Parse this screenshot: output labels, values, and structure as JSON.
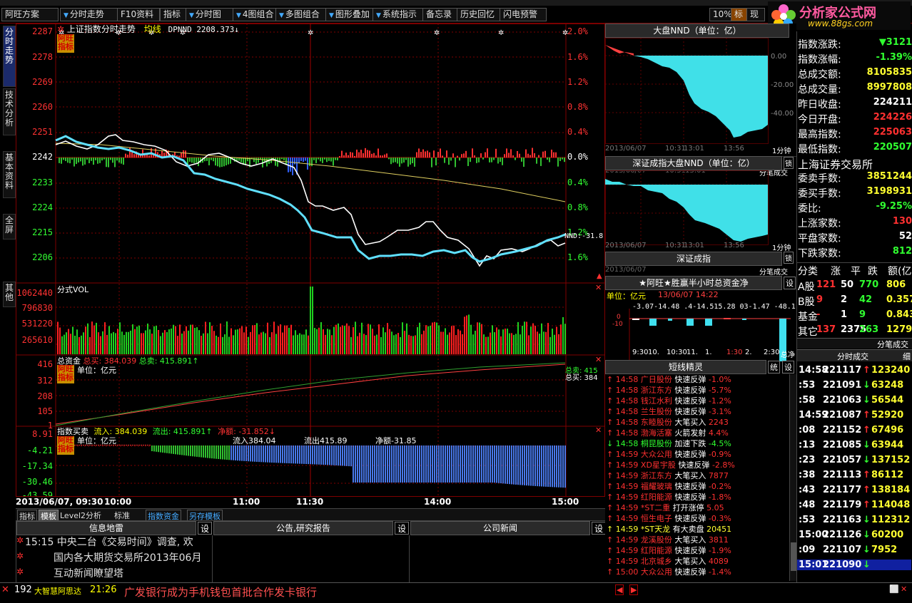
{
  "menu": [
    "阿旺方案",
    "分时走势",
    "F10资料",
    "指标",
    "分时图",
    "4图组合",
    "多图组合",
    "图形叠加",
    "系统指示",
    "备忘录",
    "历史回忆",
    "闪电预警",
    "10%",
    "标",
    "现"
  ],
  "brand": {
    "name": "分析家公式网",
    "url": "www.88gs.com"
  },
  "left_tabs": [
    "分时走势",
    "技术分析",
    "基本资料",
    "全屏",
    "其他"
  ],
  "main": {
    "title": "上证指数分时走势",
    "avg_label": "均线",
    "dpnnd": "DPNND 2208.373↓",
    "y_left": [
      "2287",
      "2278",
      "2269",
      "2260",
      "2251",
      "2242",
      "2233",
      "2224",
      "2215",
      "2206"
    ],
    "y_right": [
      "2.0%",
      "1.6%",
      "1.2%",
      "0.8%",
      "0.4%",
      "0.0%",
      "0.4%",
      "0.8%",
      "1.2%",
      "1.6%"
    ],
    "nnd_tag": "NND:-31.8",
    "badge": "阿旺指标"
  },
  "vol": {
    "title": "分式VOL",
    "y": [
      "1062440",
      "796830",
      "531220",
      "265610"
    ]
  },
  "fund": {
    "title": "总资金",
    "buy": "总买: 384.039",
    "sell": "总卖: 415.891↑",
    "unit": "单位：亿元",
    "y": [
      "416",
      "312",
      "208",
      "105",
      "1"
    ],
    "right1": "总卖: 415",
    "right2": "总买: 384"
  },
  "flow": {
    "title": "指数买卖",
    "in": "流入: 384.039",
    "out": "流出: 415.891↑",
    "net": "净额: -31.852↓",
    "unit": "单位：亿元",
    "in2": "流入384.04",
    "out2": "流出415.89",
    "net2": "净额-31.85",
    "y": [
      "8.91",
      "-4.21",
      "-17.34",
      "-30.46",
      "-43.59"
    ]
  },
  "xaxis": [
    "2013/06/07, 09:30",
    "10:00",
    "11:00",
    "11:30",
    "14:00",
    "15:00"
  ],
  "bottom_tabs": [
    "指标",
    "模板",
    "Level2分析",
    "标准",
    "指数资金",
    "另存模板"
  ],
  "news": {
    "col1": "信息地雷",
    "col2": "公告,研究报告",
    "col3": "公司新闻",
    "set": "设",
    "items": [
      "15:15 中央二台《交易时间》调查, 欢",
      "国内各大期货交易所2013年06月",
      "互动新闻瞭望塔"
    ]
  },
  "mid": {
    "p1_title": "大盘NND（单位：亿）",
    "p1_ticks": [
      "0.00",
      "-20.00",
      "-40.00"
    ],
    "p1_x": [
      "2013/06/07",
      "10:31",
      "13:01",
      "13:56"
    ],
    "p1_unit": "1分钟",
    "p1_sub": "分笔成交",
    "p2_title": "深证成指大盘NND（单位：亿）",
    "p2_x": [
      "2013/06/07",
      "10:31",
      "13:01",
      "13:56"
    ],
    "p2_unit": "1分钟",
    "p2_sub": "分笔成交",
    "p3_title": "深证成指",
    "p4_title": "★阿旺★胜赢半小时总资金净",
    "p4_unit": "单位：亿元",
    "p4_date": "13/06/07 14:22",
    "p4_vals": "-3.07-14.48 .4-14.515.28 03-1.47 -48.1",
    "p4_x": [
      "9:30",
      "10.",
      "10:30",
      "11.",
      "1.",
      "1:30",
      "2.",
      "2:30",
      "总净"
    ],
    "p5_title": "短线精灵",
    "p5_tabs": [
      "统",
      "设"
    ],
    "sprite": [
      {
        "t": "14:58",
        "n": "广日股份",
        "e": "快速反弹",
        "v": "-1.0%",
        "c": "r"
      },
      {
        "t": "14:58",
        "n": "浙江东方",
        "e": "快速反弹",
        "v": "-5.7%",
        "c": "r"
      },
      {
        "t": "14:58",
        "n": "钱江水利",
        "e": "快速反弹",
        "v": "-1.2%",
        "c": "r"
      },
      {
        "t": "14:58",
        "n": "兰生股份",
        "e": "快速反弹",
        "v": "-3.1%",
        "c": "r"
      },
      {
        "t": "14:58",
        "n": "东睦股份",
        "e": "大笔买入",
        "v": "2243",
        "c": "r"
      },
      {
        "t": "14:58",
        "n": "渤海活塞",
        "e": "火箭发射",
        "v": "4.4%",
        "c": "r"
      },
      {
        "t": "14:58",
        "n": "桐昆股份",
        "e": "加速下跌",
        "v": "-4.5%",
        "c": "g"
      },
      {
        "t": "14:59",
        "n": "大众公用",
        "e": "快速反弹",
        "v": "-0.9%",
        "c": "r"
      },
      {
        "t": "14:59",
        "n": "XD星宇股",
        "e": "快速反弹",
        "v": "-2.8%",
        "c": "r"
      },
      {
        "t": "14:59",
        "n": "浙江东方",
        "e": "大笔买入",
        "v": "7877",
        "c": "r"
      },
      {
        "t": "14:59",
        "n": "福耀玻璃",
        "e": "快速反弹",
        "v": "-0.2%",
        "c": "r"
      },
      {
        "t": "14:59",
        "n": "红阳能源",
        "e": "快速反弹",
        "v": "-1.8%",
        "c": "r"
      },
      {
        "t": "14:59",
        "n": "*ST二重",
        "e": "打开涨停",
        "v": "5.05",
        "c": "r"
      },
      {
        "t": "14:59",
        "n": "恒生电子",
        "e": "快速反弹",
        "v": "-0.3%",
        "c": "r"
      },
      {
        "t": "14:59",
        "n": "*ST天龙",
        "e": "有大卖盘",
        "v": "20451",
        "c": "y"
      },
      {
        "t": "14:59",
        "n": "龙溪股份",
        "e": "大笔买入",
        "v": "3811",
        "c": "r"
      },
      {
        "t": "14:59",
        "n": "红阳能源",
        "e": "快速反弹",
        "v": "-1.9%",
        "c": "r"
      },
      {
        "t": "14:59",
        "n": "北京城乡",
        "e": "大笔买入",
        "v": "4089",
        "c": "r"
      },
      {
        "t": "15:00",
        "n": "大众公用",
        "e": "快速反弹",
        "v": "-1.4%",
        "c": "r"
      }
    ]
  },
  "quote": {
    "rows": [
      {
        "k": "指数涨跌:",
        "v": "▼3121"
      },
      {
        "k": "指数涨幅:",
        "v": "-1.39%"
      },
      {
        "k": "总成交额:",
        "v": "8105835"
      },
      {
        "k": "总成交量:",
        "v": "8997808"
      },
      {
        "k": "昨日收盘:",
        "v": "224211"
      },
      {
        "k": "今日开盘:",
        "v": "224226"
      },
      {
        "k": "最高指数:",
        "v": "225063"
      },
      {
        "k": "最低指数:",
        "v": "220507"
      }
    ],
    "exchange": "上海证券交易所",
    "rows2": [
      {
        "k": "委卖手数:",
        "v": "3851244"
      },
      {
        "k": "委买手数:",
        "v": "3198931"
      },
      {
        "k": "委比:",
        "v": "-9.25%"
      },
      {
        "k": "上涨家数:",
        "v": "130"
      },
      {
        "k": "平盘家数:",
        "v": "52"
      },
      {
        "k": "下跌家数:",
        "v": "812"
      }
    ],
    "cat_head": [
      "分类",
      "涨",
      "平",
      "跌",
      "额(亿"
    ],
    "cats": [
      {
        "n": "A股",
        "up": "121",
        "flat": "50",
        "down": "770",
        "amt": "806"
      },
      {
        "n": "B股",
        "up": "9",
        "flat": "2",
        "down": "42",
        "amt": "0.357"
      },
      {
        "n": "基金",
        "up": "-",
        "flat": "1",
        "down": "9",
        "amt": "0.843"
      },
      {
        "n": "其它",
        "up": "137",
        "flat": "2375",
        "down": "263",
        "amt": "1279"
      }
    ],
    "tabs2": [
      "分笔成交",
      "分时成交",
      "细"
    ],
    "ticks": [
      {
        "t": "14:58",
        "p": "221117",
        "d": "↑",
        "v": "123240",
        "c": "r"
      },
      {
        "t": ":53",
        "p": "221091",
        "d": "↓",
        "v": "63248",
        "c": "g"
      },
      {
        "t": ":58",
        "p": "221063",
        "d": "↓",
        "v": "56544",
        "c": "g"
      },
      {
        "t": "14:59",
        "p": "221087",
        "d": "↑",
        "v": "52920",
        "c": "r"
      },
      {
        "t": ":08",
        "p": "221152",
        "d": "↑",
        "v": "67496",
        "c": "r"
      },
      {
        "t": ":13",
        "p": "221085",
        "d": "↓",
        "v": "63944",
        "c": "g"
      },
      {
        "t": ":23",
        "p": "221057",
        "d": "↓",
        "v": "137152",
        "c": "g"
      },
      {
        "t": ":38",
        "p": "221113",
        "d": "↑",
        "v": "86112",
        "c": "r"
      },
      {
        "t": ":43",
        "p": "221177",
        "d": "↑",
        "v": "138184",
        "c": "r"
      },
      {
        "t": ":48",
        "p": "221179",
        "d": "↑",
        "v": "114048",
        "c": "r"
      },
      {
        "t": ":53",
        "p": "221163",
        "d": "↓",
        "v": "112312",
        "c": "g"
      },
      {
        "t": "15:00",
        "p": "221126",
        "d": "↓",
        "v": "60200",
        "c": "g"
      },
      {
        "t": ":09",
        "p": "221107",
        "d": "↓",
        "v": "7952",
        "c": "g"
      },
      {
        "t": "15:01",
        "p": "221090",
        "d": "↓",
        "v": "",
        "c": "g"
      }
    ]
  },
  "status": {
    "code": "192",
    "sender": "大智慧阿思达",
    "time": "21:26",
    "msg": "广发银行成为手机钱包首批合作发卡银行"
  }
}
